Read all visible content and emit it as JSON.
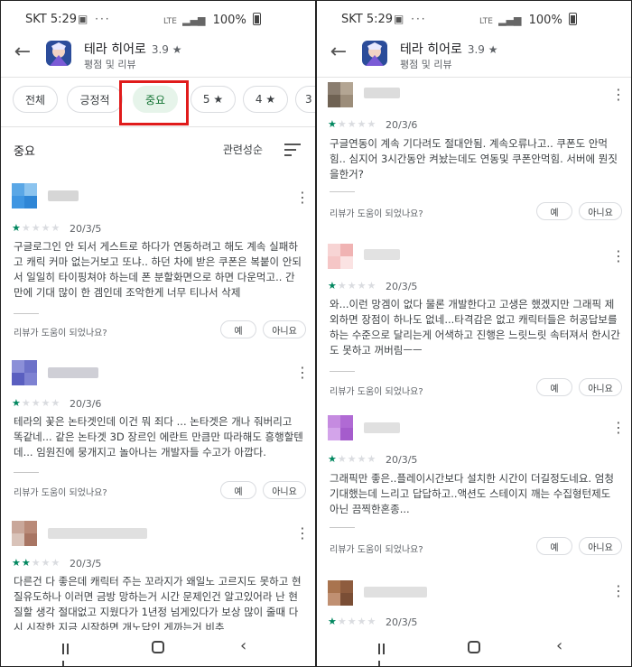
{
  "status_bar": {
    "carrier": "SKT 5:29",
    "battery": "100%",
    "network": "LTE"
  },
  "app": {
    "title": "테라 히어로",
    "rating": "3.9",
    "star_glyph": "★",
    "subtitle": "평점 및 리뷰"
  },
  "filters": [
    {
      "label": "전체",
      "active": false
    },
    {
      "label": "긍정적",
      "active": false
    },
    {
      "label": "중요",
      "active": true
    },
    {
      "label": "5 ★",
      "active": false
    },
    {
      "label": "4 ★",
      "active": false
    },
    {
      "label": "3",
      "active": false
    }
  ],
  "sort": {
    "section_title": "중요",
    "sort_label": "관련성순"
  },
  "helpful": {
    "question": "리뷰가 도움이 되었나요?",
    "yes": "예",
    "no": "아니요"
  },
  "left_reviews": [
    {
      "stars": 1,
      "date": "20/3/5",
      "text": "구글로그인 안 되서 게스트로 하다가 연동하려고 해도 계속 실패하고 캐릭 커마 없는거보고 또냐.. 하던 차에 받은 쿠폰은 복붙이 안되서 일일히 타이핑쳐야 하는데 폰 분할화면으로 하면 다운먹고.. 간만에 기대 많이 한 겜인데 조악한게 너무 티나서 삭제"
    },
    {
      "stars": 1,
      "date": "20/3/6",
      "text": "테라의 꽃은 논타겟인데 이건 뭐 죄다 ... 논타겟은 개나 줘버리고 똑같네... 같은 논타겟 3D 장르인 에란트 만큼만 따라해도 흥행할텐데... 임원진에 뭉개지고 놀아나는 개발자들 수고가 아깝다."
    },
    {
      "stars": 2,
      "date": "20/3/5",
      "text": "다른건 다 좋은데 캐릭터 주는 꼬라지가 왜일노 고르지도 못하고 현질유도하나 이러면 금방 망하는거 시간 문제인건 알고있어라 난 현질할 생각 절대없고 지웠다가 1년정 넘게있다가 보상 많이 줄때 다시 시작한 지금 시작하면 개노답인 게까는거 비추"
    }
  ],
  "right_reviews": [
    {
      "stars": 1,
      "date": "20/3/6",
      "text": "구글연동이 계속 기다려도 절대안됨. 계속오류나고.. 쿠폰도 안먹힘.. 심지어 3시간동안 켜놨는데도 연동및 쿠폰안먹힘. 서버에 뭔짓을한거?"
    },
    {
      "stars": 1,
      "date": "20/3/5",
      "text": "와...이런 망겜이 없다 물론 개발한다고 고생은 했겠지만 그래픽 제외하면 장점이 하나도 없네...타격감은 없고 캐릭터들은 허공답보를 하는 수준으로 달리는게 어색하고 진행은 느릿느릿 속터져서 한시간도 못하고 꺼버림ㅡㅡ"
    },
    {
      "stars": 1,
      "date": "20/3/5",
      "text": "그래픽만 좋은..플레이시간보다 설치한 시간이 더길정도네요. 엄청 기대했는데 느리고 답답하고..액션도 스테이지 깨는 수집형턴제도 아닌 끔찍한혼종..."
    },
    {
      "stars": 1,
      "date": "20/3/5",
      "text": ""
    }
  ],
  "colors": {
    "accent": "#01875f",
    "chip_active_bg": "#e6f4ea",
    "chip_active_text": "#137333",
    "highlight": "#e01b1b"
  }
}
